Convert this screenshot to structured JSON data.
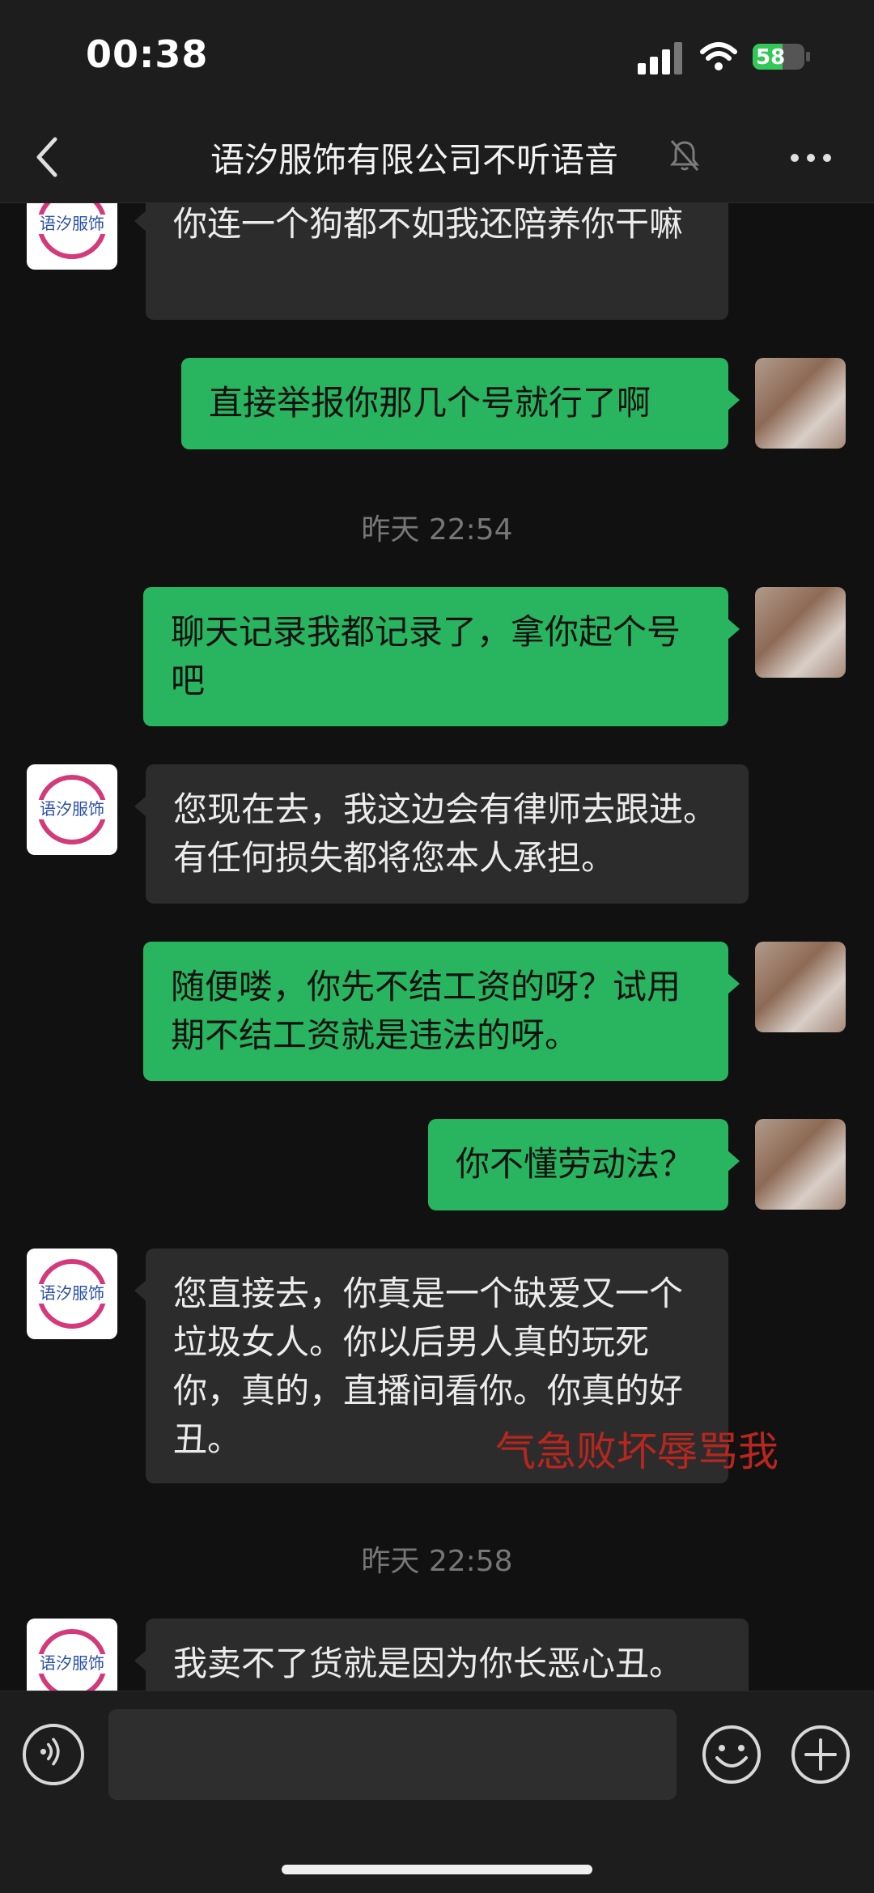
{
  "status_bar": {
    "time": "00:38",
    "battery": "58",
    "battery_level": 0.58
  },
  "header": {
    "title": "语汐服饰有限公司不听语音"
  },
  "brand_logo_text": "语汐服饰",
  "messages": [
    {
      "side": "in",
      "text": "你连一个狗都不如我还陪养你干嘛"
    },
    {
      "side": "out",
      "text": "直接举报你那几个号就行了啊"
    },
    {
      "side": "out",
      "text": "聊天记录我都记录了，拿你起个号吧"
    },
    {
      "side": "in",
      "text": "您现在去，我这边会有律师去跟进。有任何损失都将您本人承担。"
    },
    {
      "side": "out",
      "text": "随便喽，你先不结工资的呀？试用期不结工资就是违法的呀。"
    },
    {
      "side": "out",
      "text": "你不懂劳动法？"
    },
    {
      "side": "in",
      "text": "您直接去，你真是一个缺爱又一个垃圾女人。你以后男人真的玩死你，真的，直播间看你。你真的好丑。"
    },
    {
      "side": "in",
      "text": "我卖不了货就是因为你长恶心丑。"
    }
  ],
  "timestamps": [
    "昨天 22:54",
    "昨天 22:58"
  ],
  "annotation": "气急败坏辱骂我",
  "colors": {
    "outgoing_bubble": "#29b560",
    "incoming_bubble": "#2c2c2c",
    "annotation": "#b7261f"
  }
}
